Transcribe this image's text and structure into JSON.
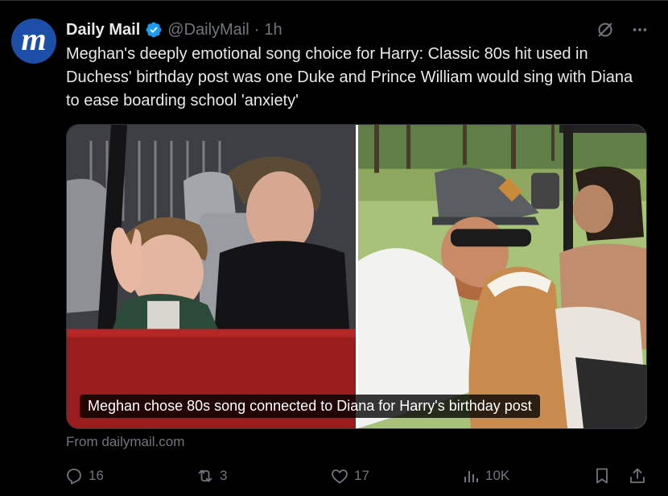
{
  "author": {
    "name": "Daily Mail",
    "handle": "@DailyMail",
    "separator": "·",
    "time": "1h",
    "avatar_letter": "m",
    "avatar_color": "#1d4fa8"
  },
  "tweet": {
    "text": "Meghan's deeply emotional song choice for Harry: Classic 80s hit used in Duchess' birthday post was one Duke and Prince William would sing with Diana to ease boarding school 'anxiety'"
  },
  "media": {
    "caption": "Meghan chose 80s song connected to Diana for Harry's birthday post"
  },
  "source": "From dailymail.com",
  "actions": {
    "replies": "16",
    "reposts": "3",
    "likes": "17",
    "views": "10K"
  },
  "icons": {
    "verified": "verified-badge-icon",
    "grok": "grok-icon",
    "more": "more-icon",
    "reply": "reply-icon",
    "repost": "repost-icon",
    "like": "heart-icon",
    "views": "views-icon",
    "bookmark": "bookmark-icon",
    "share": "share-icon"
  },
  "colors": {
    "background": "#000000",
    "text": "#e7e9ea",
    "muted": "#71767b",
    "verified": "#1d9bf0",
    "border": "#2f3336"
  }
}
